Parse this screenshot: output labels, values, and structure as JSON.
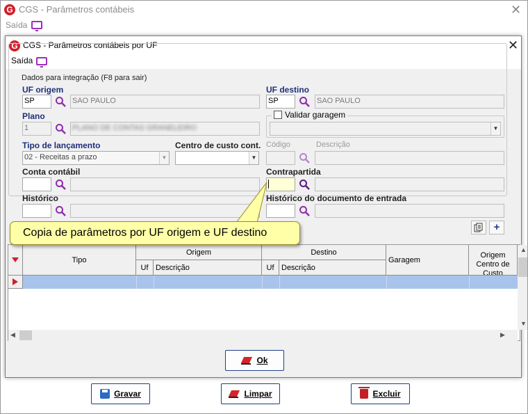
{
  "outer": {
    "title": "CGS - Parâmetros contábeis",
    "menu_saida": "Saída",
    "logo_letter": "G",
    "close_glyph": "✕"
  },
  "dialog": {
    "title": "CGS - Parâmetros contábeis por UF",
    "menu_saida": "Saída",
    "logo_letter": "G",
    "close_glyph": "✕"
  },
  "form": {
    "group_title": "Dados para integração  (F8 para sair)",
    "uf_origem": {
      "label": "UF origem",
      "value": "SP",
      "desc": "SAO PAULO"
    },
    "uf_destino": {
      "label": "UF destino",
      "value": "SP",
      "desc": "SAO PAULO"
    },
    "plano": {
      "label": "Plano",
      "value": "1",
      "desc": "PLANO DE CONTAS GRANELEIRO"
    },
    "validar_garagem": {
      "label": "Validar garagem",
      "checked": false
    },
    "tipo_lancamento": {
      "label": "Tipo de lançamento",
      "value": "02 - Receitas a prazo"
    },
    "centro_custo": {
      "label": "Centro de custo cont.",
      "value": ""
    },
    "codigo": {
      "label": "Código"
    },
    "descricao": {
      "label": "Descrição"
    },
    "conta_contabil": {
      "label": "Conta contábil"
    },
    "contrapartida": {
      "label": "Contrapartida"
    },
    "historico": {
      "label": "Histórico"
    },
    "historico_doc": {
      "label": "Histórico do documento de entrada"
    }
  },
  "tooltip": "Copia de parâmetros por UF origem e UF destino",
  "grid": {
    "columns": {
      "tipo": "Tipo",
      "origem": "Origem",
      "destino": "Destino",
      "uf": "Uf",
      "descricao": "Descrição",
      "garagem": "Garagem",
      "origem_centro": "Origem Centro de Custo"
    }
  },
  "buttons": {
    "ok": "Ok",
    "gravar": "Gravar",
    "limpar": "Limpar",
    "excluir": "Excluir"
  },
  "colors": {
    "logo": "#d11f2c",
    "label_blue": "#1f2f7a",
    "selected_row": "#a8c4ec",
    "tooltip_bg": "#ffffa8",
    "search_icon": "#8e2cae"
  }
}
